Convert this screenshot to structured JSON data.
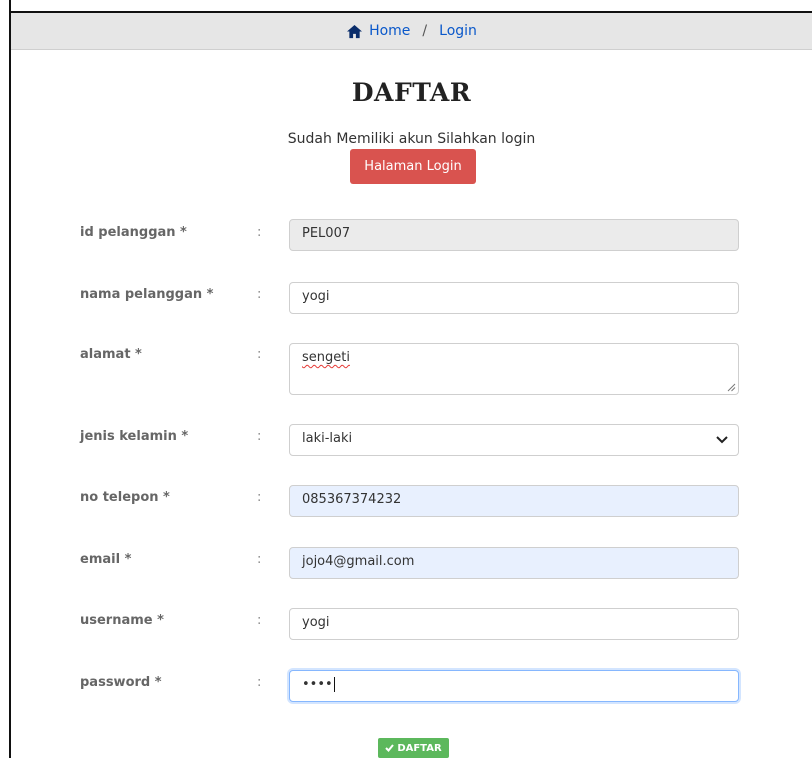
{
  "breadcrumb": {
    "home_label": "Home",
    "separator": "/",
    "current": "Login"
  },
  "page": {
    "title": "DAFTAR",
    "subtitle": "Sudah Memiliki akun Silahkan login",
    "login_button": "Halaman Login"
  },
  "form": {
    "colon": ":",
    "fields": [
      {
        "label": "id pelanggan *",
        "value": "PEL007"
      },
      {
        "label": "nama pelanggan *",
        "value": "yogi"
      },
      {
        "label": "alamat *",
        "value": "sengeti"
      },
      {
        "label": "jenis kelamin *",
        "value": "laki-laki"
      },
      {
        "label": "no telepon *",
        "value": "085367374232"
      },
      {
        "label": "email *",
        "value": "jojo4@gmail.com"
      },
      {
        "label": "username *",
        "value": "yogi"
      },
      {
        "label": "password *",
        "value": "••••"
      }
    ],
    "submit_label": "DAFTAR"
  },
  "colors": {
    "primary_link": "#0a58ca",
    "danger": "#d9534f",
    "success": "#5cb85c",
    "autofill": "#e8f0fe"
  }
}
